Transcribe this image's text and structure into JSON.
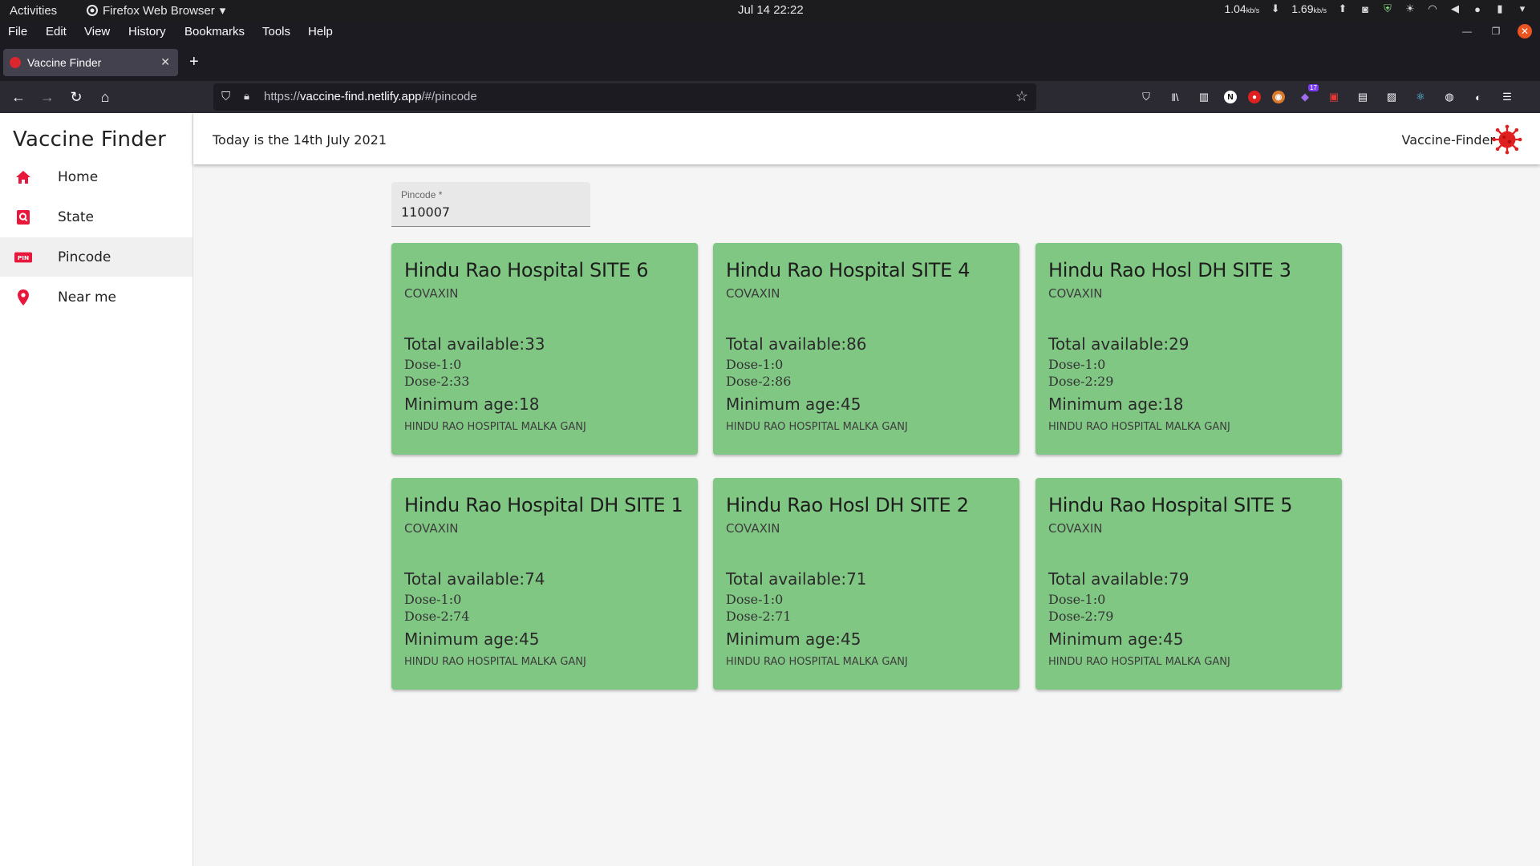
{
  "system": {
    "activities": "Activities",
    "app_name": "Firefox Web Browser",
    "clock": "Jul 14  22:22",
    "net_down": "1.04",
    "net_down_unit": "kb/s",
    "net_up": "1.69",
    "net_up_unit": "kb/s"
  },
  "browser": {
    "menu": [
      "File",
      "Edit",
      "View",
      "History",
      "Bookmarks",
      "Tools",
      "Help"
    ],
    "tab_title": "Vaccine Finder",
    "url_prefix": "https://",
    "url_domain": "vaccine-find.netlify.app",
    "url_path": "/#/pincode",
    "ext_badge": "17"
  },
  "app": {
    "brand": "Vaccine Finder",
    "date_text": "Today is the 14th July 2021",
    "brand_right": "Vaccine-Finder",
    "nav": [
      {
        "label": "Home",
        "icon": "home-icon"
      },
      {
        "label": "State",
        "icon": "search-icon"
      },
      {
        "label": "Pincode",
        "icon": "pin-icon"
      },
      {
        "label": "Near me",
        "icon": "location-icon"
      }
    ],
    "active_nav": "Pincode",
    "accent_color": "#e8173c",
    "card_color": "#81c784",
    "pincode": {
      "label": "Pincode *",
      "value": "110007"
    }
  },
  "centers": [
    {
      "name": "Hindu Rao Hospital SITE 6",
      "vaccine": "COVAXIN",
      "total": "Total available:33",
      "dose1": "Dose-1:0",
      "dose2": "Dose-2:33",
      "min_age": "Minimum age:18",
      "address": "HINDU RAO HOSPITAL MALKA GANJ"
    },
    {
      "name": "Hindu Rao Hospital SITE 4",
      "vaccine": "COVAXIN",
      "total": "Total available:86",
      "dose1": "Dose-1:0",
      "dose2": "Dose-2:86",
      "min_age": "Minimum age:45",
      "address": "HINDU RAO HOSPITAL MALKA GANJ"
    },
    {
      "name": "Hindu Rao Hosl DH SITE 3",
      "vaccine": "COVAXIN",
      "total": "Total available:29",
      "dose1": "Dose-1:0",
      "dose2": "Dose-2:29",
      "min_age": "Minimum age:18",
      "address": "HINDU RAO HOSPITAL MALKA GANJ"
    },
    {
      "name": "Hindu Rao Hospital DH SITE 1",
      "vaccine": "COVAXIN",
      "total": "Total available:74",
      "dose1": "Dose-1:0",
      "dose2": "Dose-2:74",
      "min_age": "Minimum age:45",
      "address": "HINDU RAO HOSPITAL MALKA GANJ"
    },
    {
      "name": "Hindu Rao Hosl DH SITE 2",
      "vaccine": "COVAXIN",
      "total": "Total available:71",
      "dose1": "Dose-1:0",
      "dose2": "Dose-2:71",
      "min_age": "Minimum age:45",
      "address": "HINDU RAO HOSPITAL MALKA GANJ"
    },
    {
      "name": "Hindu Rao Hospital SITE 5",
      "vaccine": "COVAXIN",
      "total": "Total available:79",
      "dose1": "Dose-1:0",
      "dose2": "Dose-2:79",
      "min_age": "Minimum age:45",
      "address": "HINDU RAO HOSPITAL MALKA GANJ"
    }
  ]
}
